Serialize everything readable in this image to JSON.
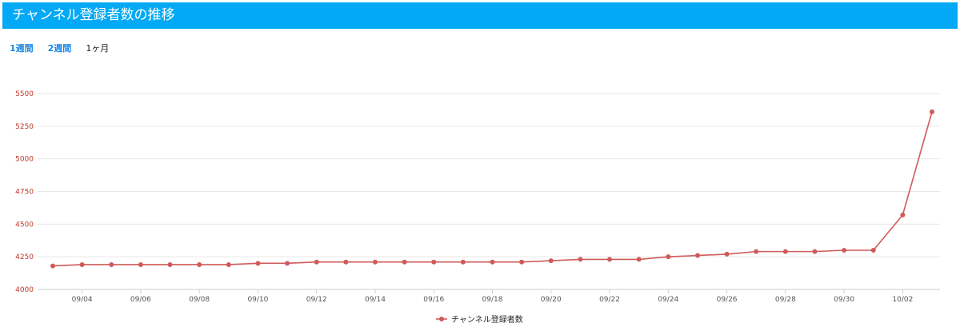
{
  "header": {
    "title": "チャンネル登録者数の推移"
  },
  "tabs": [
    {
      "label": "1週間",
      "active": false
    },
    {
      "label": "2週間",
      "active": false
    },
    {
      "label": "1ヶ月",
      "active": true
    }
  ],
  "colors": {
    "header_bg": "#03a9f4",
    "tab_link": "#1e88e5",
    "series": "#d05a5a",
    "grid": "#e6e6e6",
    "y_tick": "#c0392b"
  },
  "chart_data": {
    "type": "line",
    "title": "",
    "xlabel": "",
    "ylabel": "",
    "ylim": [
      4000,
      5500
    ],
    "yticks": [
      4000,
      4250,
      4500,
      4750,
      5000,
      5250,
      5500
    ],
    "x": [
      "09/03",
      "09/04",
      "09/05",
      "09/06",
      "09/07",
      "09/08",
      "09/09",
      "09/10",
      "09/11",
      "09/12",
      "09/13",
      "09/14",
      "09/15",
      "09/16",
      "09/17",
      "09/18",
      "09/19",
      "09/20",
      "09/21",
      "09/22",
      "09/23",
      "09/24",
      "09/25",
      "09/26",
      "09/27",
      "09/28",
      "09/29",
      "09/30",
      "10/01",
      "10/02",
      "10/03"
    ],
    "xtick_labels": [
      "09/04",
      "09/06",
      "09/08",
      "09/10",
      "09/12",
      "09/14",
      "09/16",
      "09/18",
      "09/20",
      "09/22",
      "09/24",
      "09/26",
      "09/28",
      "09/30",
      "10/02"
    ],
    "series": [
      {
        "name": "チャンネル登録者数",
        "values": [
          4180,
          4190,
          4190,
          4190,
          4190,
          4190,
          4190,
          4200,
          4200,
          4210,
          4210,
          4210,
          4210,
          4210,
          4210,
          4210,
          4210,
          4220,
          4230,
          4230,
          4230,
          4250,
          4260,
          4270,
          4290,
          4290,
          4290,
          4300,
          4300,
          4570,
          5360
        ]
      }
    ],
    "grid": true,
    "legend": "bottom-center"
  }
}
